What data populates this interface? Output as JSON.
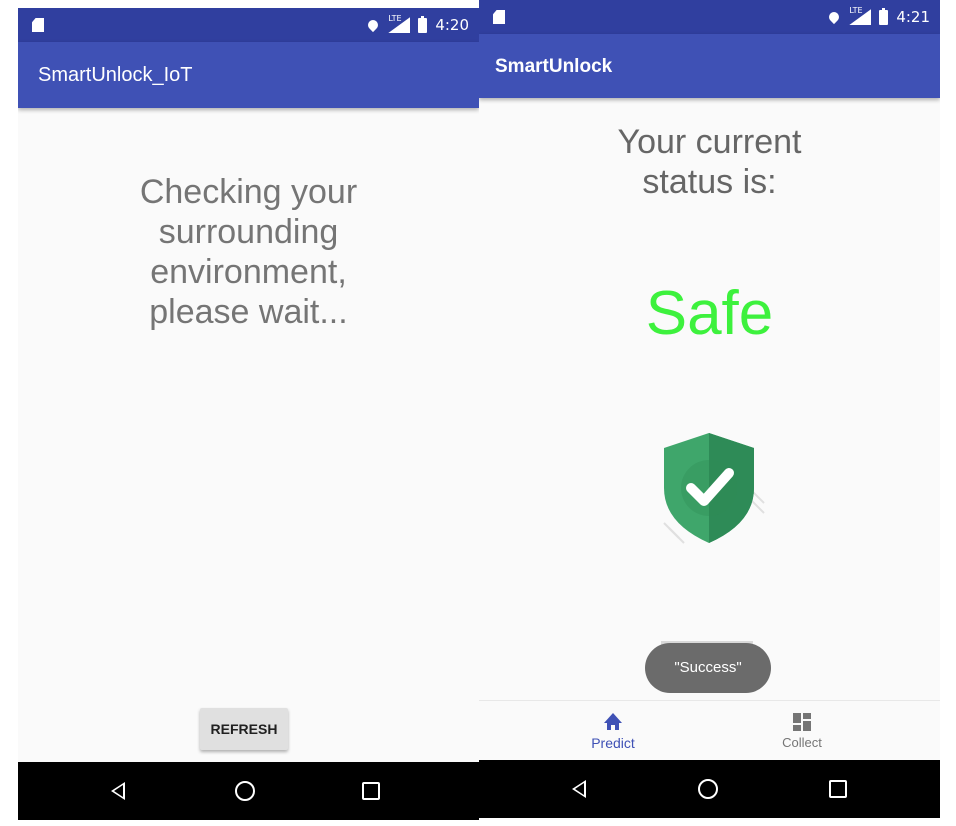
{
  "left_screen": {
    "status_bar": {
      "time": "4:20",
      "network": "LTE"
    },
    "app_title": "SmartUnlock_IoT",
    "checking_lines": [
      "Checking your",
      "surrounding",
      "environment,",
      "please wait..."
    ],
    "refresh_label": "REFRESH"
  },
  "right_screen": {
    "status_bar": {
      "time": "4:21",
      "network": "LTE"
    },
    "app_title": "SmartUnlock",
    "status_label_lines": [
      "Your current",
      "status is:"
    ],
    "status_value": "Safe",
    "status_value_color": "#3df13d",
    "icon": "shield-check-icon",
    "toast": "\"Success\"",
    "tabs": [
      {
        "label": "Predict",
        "icon": "home-icon",
        "active": true
      },
      {
        "label": "Collect",
        "icon": "dashboard-icon",
        "active": false
      }
    ]
  },
  "colors": {
    "primary": "#3f51b5",
    "primary_dark": "#303f9f",
    "safe_green": "#3df13d"
  }
}
